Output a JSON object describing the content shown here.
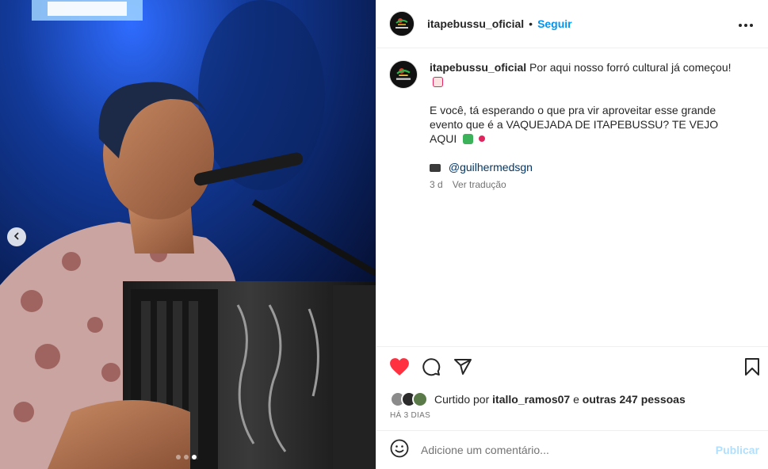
{
  "account": {
    "username": "itapebussu_oficial",
    "separator": "•",
    "follow_label": "Seguir"
  },
  "caption": {
    "username": "itapebussu_oficial",
    "line1": "Por aqui nosso forró cultural já começou!",
    "line2": "E você, tá esperando o que pra vir aproveitar esse grande evento que é a VAQUEJADA DE ITAPEBUSSU? TE VEJO AQUI",
    "credit": "@guilhermedsgn",
    "time": "3 d",
    "translate": "Ver tradução"
  },
  "likes": {
    "prefix": "Curtido por",
    "user": "itallo_ramos07",
    "and": "e",
    "others": "outras 247 pessoas"
  },
  "posted_ago": "HÁ 3 DIAS",
  "comment": {
    "placeholder": "Adicione um comentário...",
    "publish_label": "Publicar"
  },
  "icons": {
    "like": "heart-icon",
    "comment": "comment-icon",
    "share": "share-icon",
    "save": "bookmark-icon",
    "more": "more-options-icon",
    "emoji": "emoji-icon",
    "prev": "chevron-left-icon"
  },
  "colors": {
    "like_active": "#ff3040",
    "link": "#0095f6",
    "mention": "#00376b",
    "publish_disabled": "#b2dffc"
  },
  "carousel": {
    "slides": 3,
    "active_slide": 3
  }
}
